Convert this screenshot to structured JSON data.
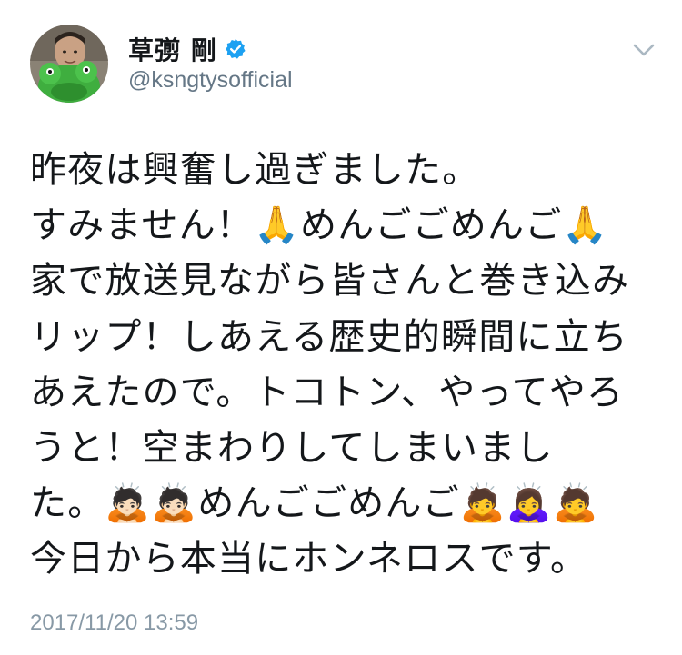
{
  "user": {
    "display_name": "草彅 剛",
    "handle": "@ksngtysofficial",
    "verified": true,
    "avatar_icon": "avatar-green-frog-plush"
  },
  "icons": {
    "verified": "verified-badge-icon",
    "menu": "chevron-down-icon"
  },
  "colors": {
    "verified_blue": "#1da1f2",
    "handle_gray": "#657786",
    "timestamp_gray": "#8899a6",
    "text": "#14171a"
  },
  "tweet": {
    "lines": [
      "昨夜は興奮し過ぎました。",
      "すみません！🙏めんごごめんご🙏",
      "家で放送見ながら皆さんと巻き込み",
      "リップ！しあえる歴史的瞬間に立ち",
      "あえたので。トコトン、やってやろ",
      "うと！空まわりしてしまいまし",
      "た。🙇🏻🙇🏻めんごごめんご🙇🙇‍♀️🙇",
      "今日から本当にホンネロスです。"
    ],
    "timestamp": "2017/11/20 13:59"
  }
}
